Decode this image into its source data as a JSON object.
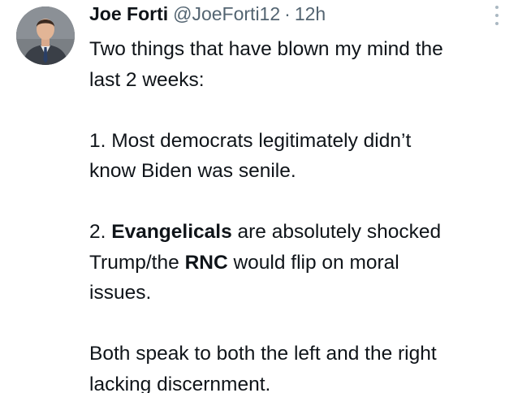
{
  "author": {
    "name": "Joe Forti",
    "handle": "@JoeForti12",
    "separator": "·",
    "time": "12h"
  },
  "tweet": {
    "line1": "Two things that have blown my mind the",
    "line2": "last 2 weeks:",
    "point1_line1": "1. Most democrats legitimately didn’t",
    "point1_line2": "know Biden was senile.",
    "point2_prefix": "2. ",
    "point2_bold1": "Evangelicals",
    "point2_mid1": " are absolutely shocked",
    "point2_line2_prefix": "Trump/the ",
    "point2_bold2": "RNC",
    "point2_line2_suffix": " would flip on moral",
    "point2_line3": "issues.",
    "closing_line1": "Both speak to both the left and the right",
    "closing_line2": "lacking discernment."
  },
  "icons": {
    "avatar": "profile-photo",
    "more": "more-options-icon"
  }
}
